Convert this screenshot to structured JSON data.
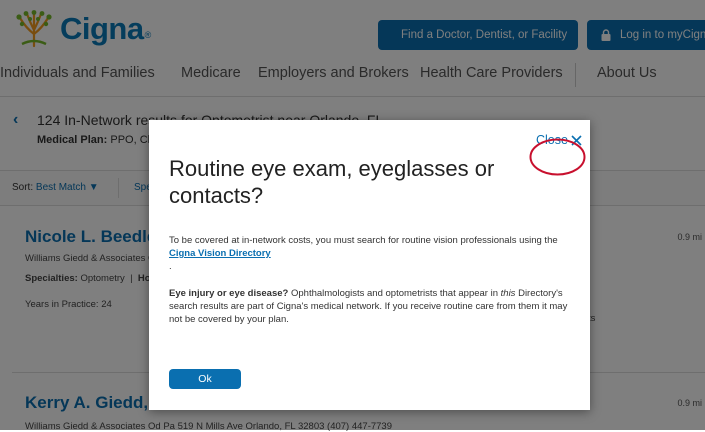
{
  "brand": {
    "name": "Cigna",
    "reg_mark": "®"
  },
  "header": {
    "find_button": "Find a Doctor, Dentist, or Facility",
    "login_button": "Log in to myCigna"
  },
  "nav": {
    "items": [
      "Individuals and Families",
      "Medicare",
      "Employers and Brokers",
      "Health Care Providers",
      "About Us"
    ]
  },
  "results": {
    "count_text": "124 In-Network results for Optometrist near Orlando, FL",
    "plan_label": "Medical Plan:",
    "plan_value": "PPO, Ch"
  },
  "sortbar": {
    "label": "Sort:",
    "value": "Best Match ▼",
    "specialty": "Spe"
  },
  "providers": [
    {
      "name": "Nicole L. Beedle",
      "practice": "Williams Giedd & Associates O",
      "specialties_label": "Specialties:",
      "specialties_value": "Optometry",
      "extra": "Ho",
      "years": "Years in Practice: 24",
      "distance": "0.9 mi",
      "trailing": "ts"
    },
    {
      "name": "Kerry A. Giedd, O",
      "practice": "Williams Giedd & Associates Od Pa   519 N Mills Ave Orlando, FL 32803   (407) 447-7739",
      "distance": "0.9 mi"
    }
  ],
  "modal": {
    "close_label": "Close",
    "title": "Routine eye exam, eyeglasses or contacts?",
    "p1_text": "To be covered at in-network costs, you must search for routine vision professionals using the",
    "p1_link": "Cigna Vision Directory",
    "p1_dot": ".",
    "p2_bold": "Eye injury or eye disease?",
    "p2_a": " Ophthalmologists and optometrists that appear in ",
    "p2_em": "this",
    "p2_b": " Directory's search results are part of Cigna's medical network. If you receive routine care from them it may not be covered by your plan.",
    "ok_label": "Ok"
  },
  "colors": {
    "brand_blue": "#0a6fb0",
    "annotation_red": "#c8102e"
  }
}
